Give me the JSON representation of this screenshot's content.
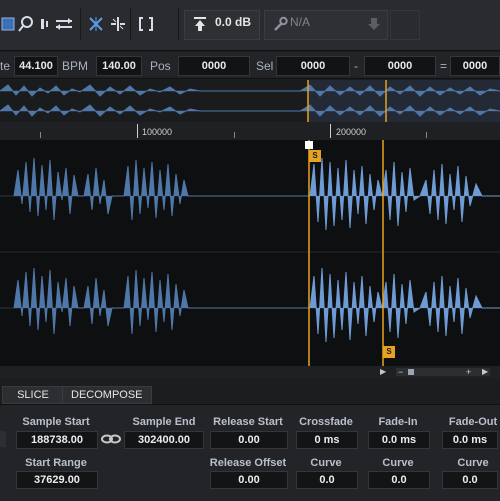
{
  "toolbar": {
    "gain_value": "0.0 dB",
    "plugin_value": "N/A",
    "icons": [
      "square-select-icon",
      "zoom-icon",
      "stretch-icon",
      "crossfade-icon",
      "split-icon",
      "brackets-icon",
      "upload-icon",
      "wrench-icon",
      "down-arrow-icon",
      "disabled-button-icon"
    ]
  },
  "infobar": {
    "rate_label_partial": "te",
    "rate_value": "44.100",
    "bpm_label": "BPM",
    "bpm_value": "140.00",
    "pos_label": "Pos",
    "pos_value": "0000",
    "sel_label": "Sel",
    "sel_start": "0000",
    "sel_dash": "-",
    "sel_end": "0000",
    "sel_eq": "=",
    "sel_len": "0000"
  },
  "ruler": {
    "ticks": [
      "100000",
      "200000"
    ]
  },
  "markers": {
    "slice_label": "S"
  },
  "tabs": {
    "slice": "SLICE",
    "decompose": "DECOMPOSE"
  },
  "params": {
    "sample_start_label": "Sample Start",
    "sample_start_value": "188738.00",
    "sample_end_label": "Sample End",
    "sample_end_value": "302400.00",
    "release_start_label": "Release Start",
    "release_start_value": "0.00",
    "crossfade_label": "Crossfade",
    "crossfade_value": "0 ms",
    "fade_in_label": "Fade-In",
    "fade_in_value": "0.0 ms",
    "fade_out_label": "Fade-Out",
    "fade_out_value": "0.0 ms",
    "start_range_label": "Start Range",
    "start_range_value": "37629.00",
    "release_offset_label": "Release Offset",
    "release_offset_value": "0.00",
    "curve1_label": "Curve",
    "curve1_value": "0.0",
    "curve2_label": "Curve",
    "curve2_value": "0.0",
    "curve3_label": "Curve",
    "curve3_value": "0.0"
  },
  "colors": {
    "waveform": "#4f77a8",
    "waveform_selected": "#6e9bd3",
    "marker": "#e7a31f",
    "background": "#0e0f10"
  }
}
